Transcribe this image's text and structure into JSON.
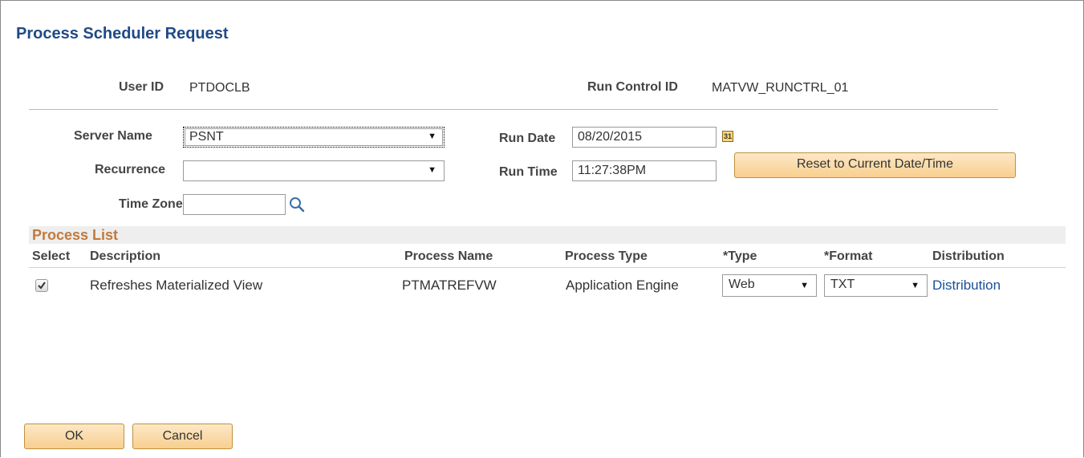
{
  "page": {
    "title": "Process Scheduler Request"
  },
  "ids": {
    "user_id_label": "User ID",
    "user_id_value": "PTDOCLB",
    "run_control_label": "Run Control ID",
    "run_control_value": "MATVW_RUNCTRL_01"
  },
  "form": {
    "server_name_label": "Server Name",
    "server_name_value": "PSNT",
    "recurrence_label": "Recurrence",
    "recurrence_value": "",
    "time_zone_label": "Time Zone",
    "time_zone_value": "",
    "run_date_label": "Run Date",
    "run_date_value": "08/20/2015",
    "run_time_label": "Run Time",
    "run_time_value": "11:27:38PM",
    "calendar_icon_text": "31",
    "reset_button": "Reset to Current Date/Time"
  },
  "process_list": {
    "title": "Process List",
    "columns": [
      "Select",
      "Description",
      "Process Name",
      "Process Type",
      "*Type",
      "*Format",
      "Distribution"
    ],
    "rows": [
      {
        "selected": true,
        "description": "Refreshes Materialized View",
        "process_name": "PTMATREFVW",
        "process_type": "Application Engine",
        "type": "Web",
        "format": "TXT",
        "distribution": "Distribution"
      }
    ]
  },
  "buttons": {
    "ok": "OK",
    "cancel": "Cancel"
  },
  "colors": {
    "title": "#1f4a87",
    "section_title": "#c17a3c",
    "link": "#1a4f9a",
    "button": "#f8cf8f"
  },
  "icons": {
    "calendar": "calendar-icon",
    "search": "search-icon",
    "dropdown": "chevron-down-icon",
    "check": "check-icon"
  }
}
